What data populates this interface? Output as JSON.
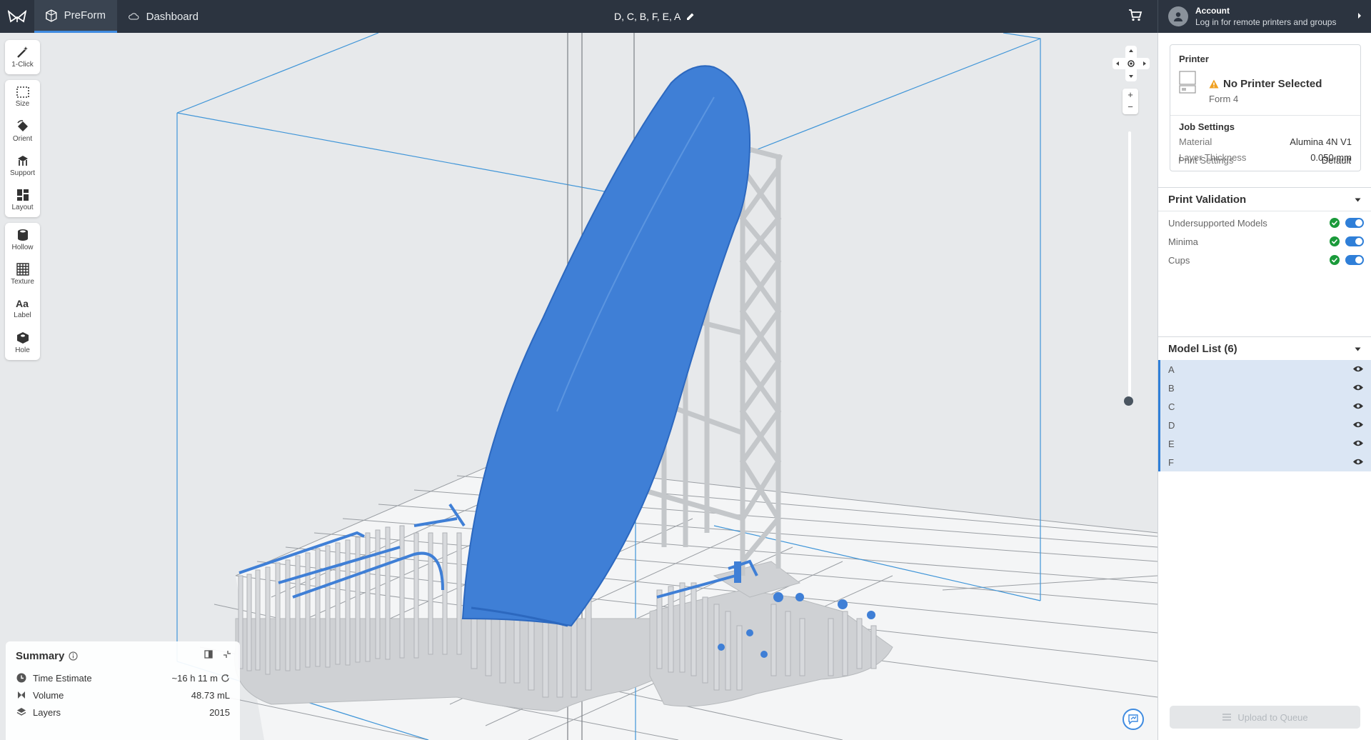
{
  "topbar": {
    "tabs": [
      {
        "label": "PreForm",
        "active": true
      },
      {
        "label": "Dashboard",
        "active": false
      }
    ],
    "document_title": "D, C, B, F, E, A",
    "account": {
      "title": "Account",
      "subtitle": "Log in for remote printers and groups"
    }
  },
  "toolbar": {
    "groups": [
      [
        {
          "label": "1-Click",
          "icon": "magic-wand-icon"
        }
      ],
      [
        {
          "label": "Size",
          "icon": "size-icon"
        },
        {
          "label": "Orient",
          "icon": "orient-icon"
        },
        {
          "label": "Support",
          "icon": "support-icon"
        },
        {
          "label": "Layout",
          "icon": "layout-icon"
        }
      ],
      [
        {
          "label": "Hollow",
          "icon": "hollow-icon"
        },
        {
          "label": "Texture",
          "icon": "texture-icon"
        },
        {
          "label": "Label",
          "icon": "label-icon"
        },
        {
          "label": "Hole",
          "icon": "hole-icon"
        }
      ]
    ]
  },
  "viewport": {
    "zoom_in": "+",
    "zoom_out": "−"
  },
  "summary": {
    "title": "Summary",
    "rows": [
      {
        "label": "Time Estimate",
        "value": "~16 h 11 m",
        "icon": "clock-icon"
      },
      {
        "label": "Volume",
        "value": "48.73 mL",
        "icon": "volume-icon"
      },
      {
        "label": "Layers",
        "value": "2015",
        "icon": "layers-icon"
      }
    ]
  },
  "printer": {
    "section_title": "Printer",
    "name": "No Printer Selected",
    "model": "Form 4",
    "job_settings_title": "Job Settings",
    "settings": [
      {
        "label": "Material",
        "value": "Alumina 4N V1"
      },
      {
        "label": "Layer Thickness",
        "value": "0.050 mm"
      },
      {
        "label": "Print Settings",
        "value": "Default"
      }
    ]
  },
  "validation": {
    "title": "Print Validation",
    "items": [
      {
        "label": "Undersupported Models",
        "enabled": true
      },
      {
        "label": "Minima",
        "enabled": true
      },
      {
        "label": "Cups",
        "enabled": true
      }
    ]
  },
  "model_list": {
    "title": "Model List (6)",
    "items": [
      "A",
      "B",
      "C",
      "D",
      "E",
      "F"
    ]
  },
  "upload_label": "Upload to Queue",
  "colors": {
    "topbar": "#2c3440",
    "accent": "#2f7fd8",
    "model_blue": "#3f7fd6",
    "support_gray": "#c8cacd",
    "status_ok": "#1a9a3a",
    "warning": "#f0a020"
  }
}
